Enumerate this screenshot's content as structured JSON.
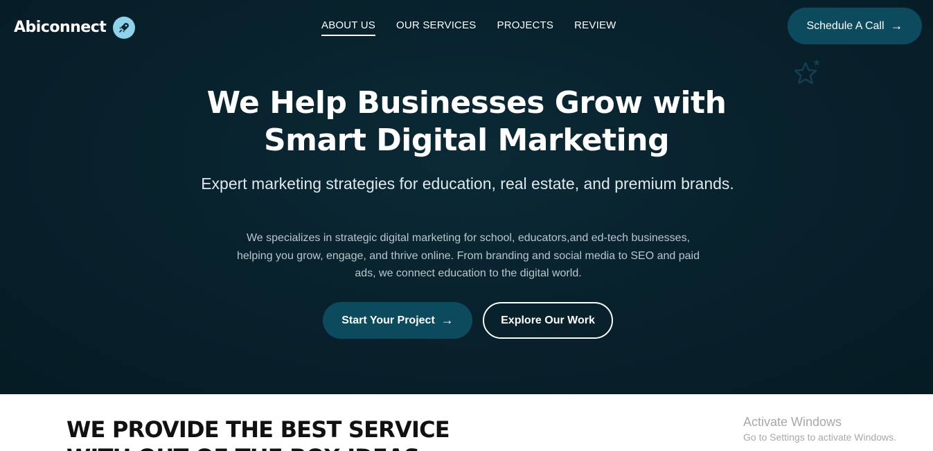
{
  "header": {
    "logo_text": "Abiconnect",
    "logo_icon": "rocket-icon",
    "nav": [
      {
        "label": "ABOUT US",
        "active": true
      },
      {
        "label": "OUR SERVICES",
        "active": false
      },
      {
        "label": "PROJECTS",
        "active": false
      },
      {
        "label": "REVIEW",
        "active": false
      }
    ],
    "cta_label": "Schedule A Call",
    "cta_arrow": "→"
  },
  "hero": {
    "headline_line1": "We Help Businesses Grow with",
    "headline_line2": "Smart Digital Marketing",
    "subheadline": "Expert marketing strategies for education, real estate, and premium brands.",
    "description": "We specializes in strategic digital marketing for school, educators,and ed-tech businesses, helping you grow, engage, and thrive online. From branding and social media to SEO and paid ads, we connect education to the digital world.",
    "primary_button": "Start Your Project",
    "primary_arrow": "→",
    "secondary_button": "Explore Our Work",
    "decoration_icon": "star-outline-icon"
  },
  "section": {
    "title_line1": "WE PROVIDE THE BEST SERVICE",
    "title_line2": "WITH OUT OF THE BOX IDEAS"
  },
  "os_watermark": {
    "title": "Activate Windows",
    "subtitle": "Go to Settings to activate Windows."
  },
  "colors": {
    "hero_background": "#08222d",
    "accent_button": "#0c4a5e",
    "logo_badge": "#8fd3ea",
    "star_outline": "#143e52"
  }
}
